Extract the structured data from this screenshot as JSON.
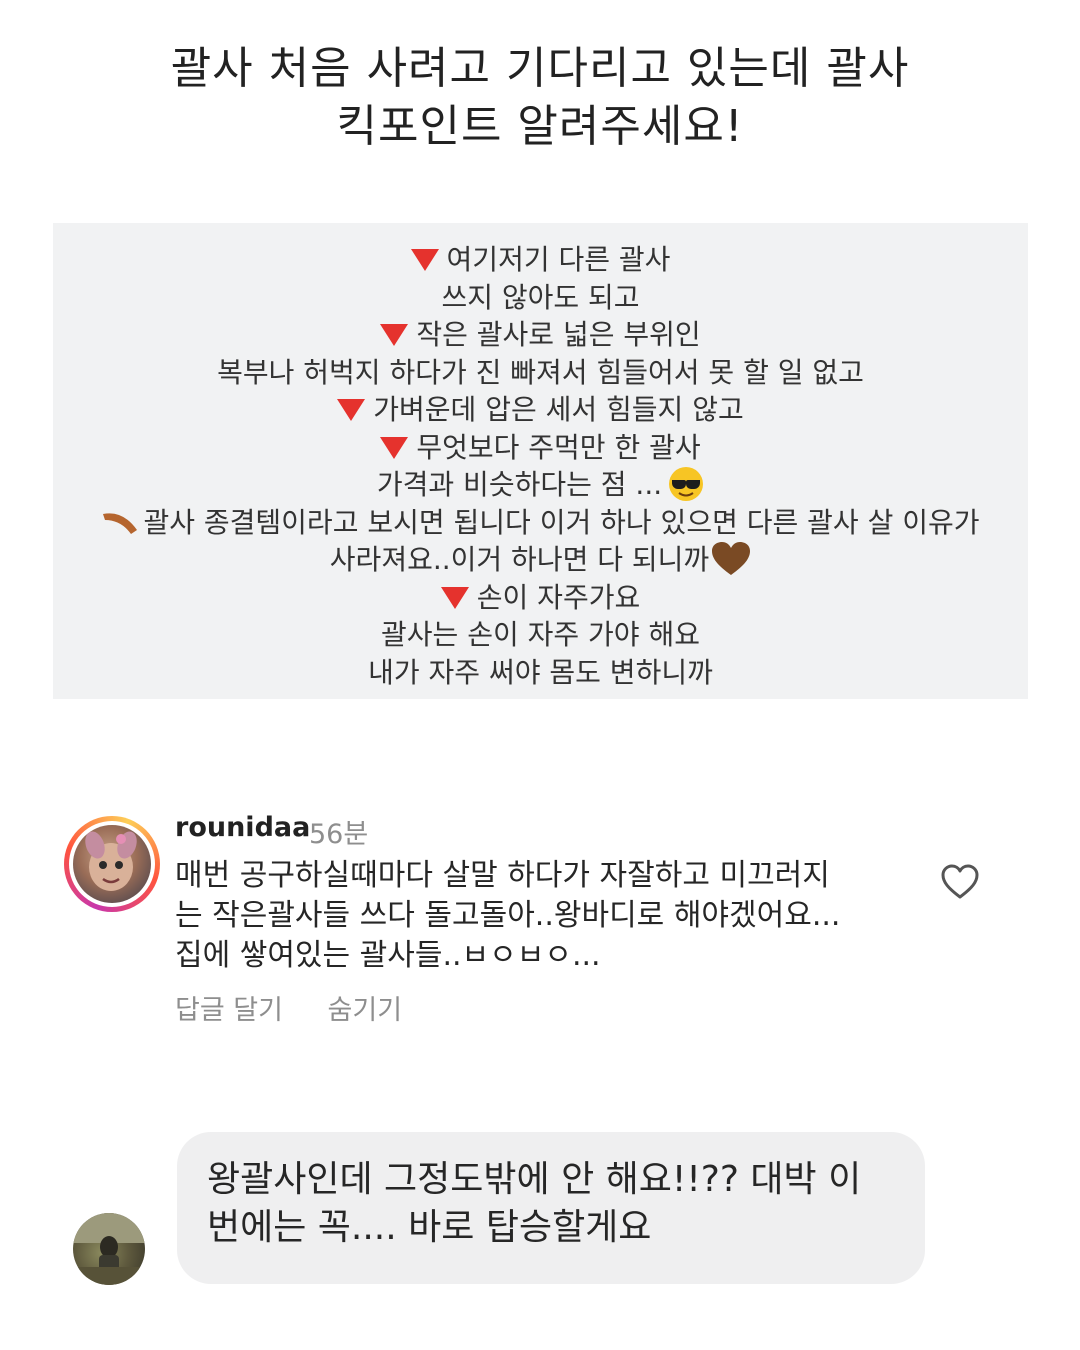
{
  "header": {
    "title_line1": "괄사 처음 사려고 기다리고 있는데 괄사",
    "title_line2": "킥포인트 알려주세요!"
  },
  "card": {
    "lines": [
      "여기저기 다른 괄사",
      "쓰지 않아도 되고",
      "작은 괄사로 넓은 부위인",
      "복부나 허벅지 하다가 진 빠져서 힘들어서 못 할 일 없고",
      "가벼운데 압은 세서 힘들지 않고",
      "무엇보다 주먹만 한 괄사",
      "가격과 비슷하다는 점 ...",
      "괄사 종결템이라고 보시면 됩니다 이거 하나 있으면 다른 괄사 살 이유가",
      "사라져요..이거 하나면 다 되니까",
      "손이 자주가요",
      "괄사는 손이 자주 가야 해요",
      "내가 자주 써야 몸도 변하니까"
    ],
    "bullet_icon": "red-triangle-icon",
    "boomerang_icon": "boomerang-icon",
    "sunglasses_icon": "sunglasses-emoji-icon",
    "heart_icon": "brown-heart-icon",
    "bullet_color": "#e5322d"
  },
  "comment": {
    "username": "rounidaa",
    "time": "56분",
    "text_line1": "매번 공구하실때마다 살말 하다가 자잘하고 미끄러지",
    "text_line2": "는 작은괄사들 쓰다 돌고돌아..왕바디로 해야겠어요...",
    "text_line3": "집에 쌓여있는 괄사들..ㅂㅇㅂㅇ...",
    "reply_label": "답글 달기",
    "hide_label": "숨기기"
  },
  "reply": {
    "text_line1": "왕괄사인데 그정도밖에 안 해요!!?? 대박 이",
    "text_line2": "번에는 꼭.... 바로 탑승할게요"
  }
}
